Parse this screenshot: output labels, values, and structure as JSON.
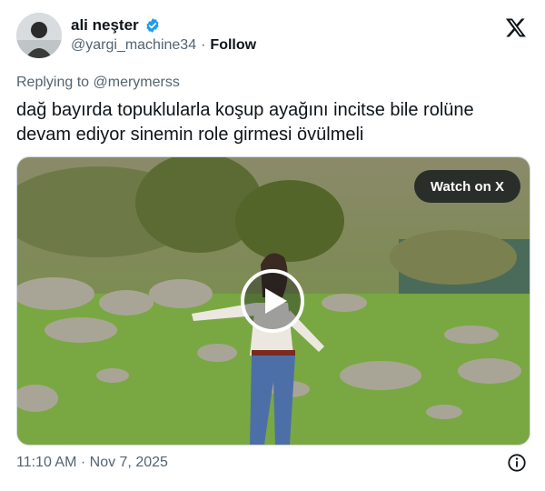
{
  "author": {
    "name": "ali neşter",
    "handle": "@yargi_machine34",
    "follow_label": "Follow",
    "separator": "·"
  },
  "reply": {
    "prefix": "Replying to",
    "mention": "@merymerss"
  },
  "tweet": {
    "text": "dağ bayırda topuklularla koşup ayağını incitse bile rolüne devam ediyor sinemin role girmesi övülmeli"
  },
  "media": {
    "watch_label": "Watch on X"
  },
  "footer": {
    "timestamp": "11:10 AM · Nov 7, 2025"
  },
  "colors": {
    "verified": "#1d9bf0",
    "text": "#0f1419",
    "muted": "#536471"
  },
  "icons": [
    "verified-badge-icon",
    "x-logo-icon",
    "play-icon",
    "info-icon"
  ]
}
